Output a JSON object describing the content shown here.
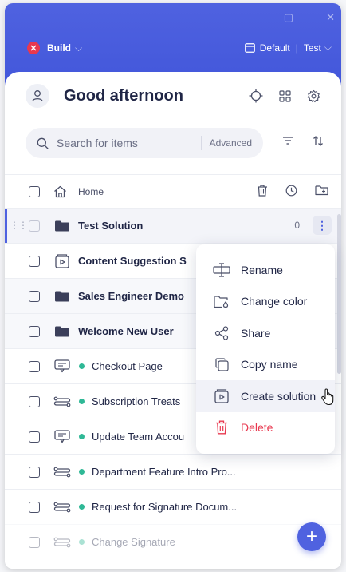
{
  "header": {
    "env_name": "Build",
    "env_badge": "✕",
    "workspace": "Default",
    "workspace_sep": "|",
    "workspace_env": "Test",
    "chevron": "⌵",
    "window_controls": [
      "▢",
      "—",
      "✕"
    ]
  },
  "greeting": {
    "title": "Good afternoon"
  },
  "search": {
    "placeholder": "Search for items",
    "advanced_label": "Advanced"
  },
  "breadcrumb": {
    "home_label": "Home"
  },
  "list": {
    "items": [
      {
        "label": "Test Solution",
        "kind": "folder",
        "count": "0"
      },
      {
        "label": "Content Suggestion S",
        "kind": "solution"
      },
      {
        "label": "Sales Engineer Demo",
        "kind": "folder"
      },
      {
        "label": "Welcome New User",
        "kind": "folder"
      },
      {
        "label": "Checkout Page",
        "kind": "tooltip-flow"
      },
      {
        "label": "Subscription Treats",
        "kind": "walkthru"
      },
      {
        "label": "Update Team Accou",
        "kind": "tooltip-flow"
      },
      {
        "label": "Department Feature Intro Pro...",
        "kind": "walkthru"
      },
      {
        "label": "Request for Signature Docum...",
        "kind": "walkthru"
      },
      {
        "label": "Change Signature",
        "kind": "walkthru"
      }
    ],
    "kebab": "⋮",
    "grip": "⋮⋮"
  },
  "context_menu": {
    "items": [
      {
        "label": "Rename",
        "icon": "rename-icon"
      },
      {
        "label": "Change color",
        "icon": "paint-bucket-icon"
      },
      {
        "label": "Share",
        "icon": "share-icon"
      },
      {
        "label": "Copy name",
        "icon": "copy-icon"
      },
      {
        "label": "Create solution",
        "icon": "solution-icon"
      },
      {
        "label": "Delete",
        "icon": "trash-icon"
      }
    ]
  },
  "fab": {
    "label": "+"
  },
  "colors": {
    "brand": "#4f62e0",
    "danger": "#e8384f",
    "published": "#2fb896",
    "text": "#1f2545"
  }
}
